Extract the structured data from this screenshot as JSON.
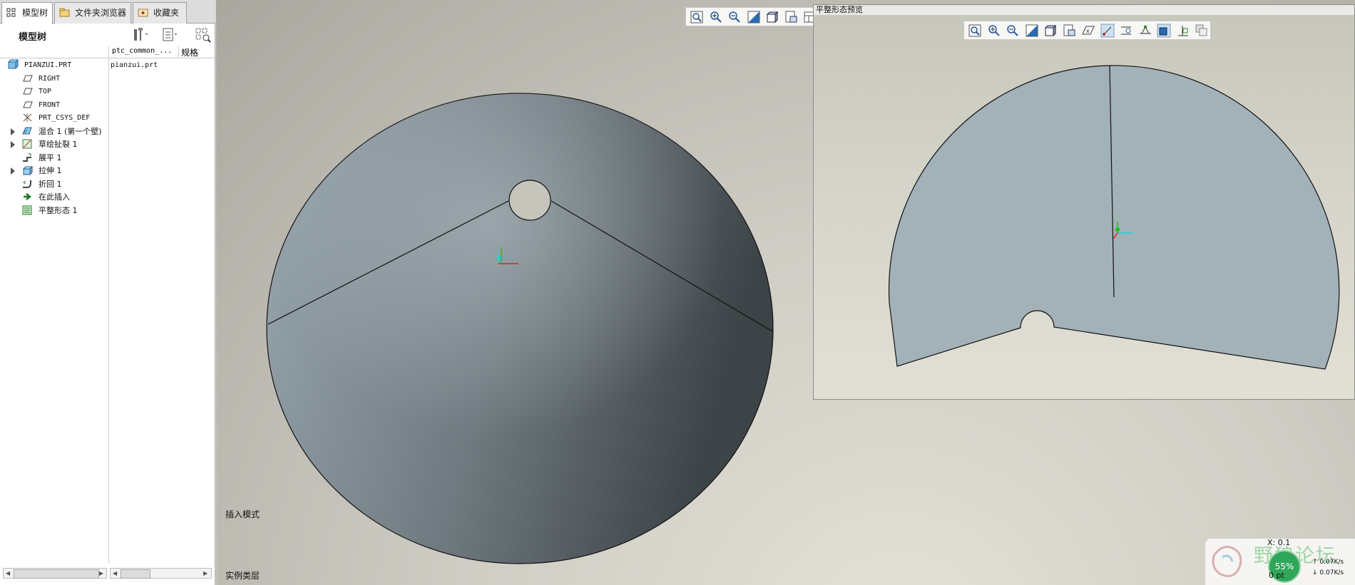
{
  "tabs": [
    {
      "label": "模型树",
      "icon": "model-tree-icon"
    },
    {
      "label": "文件夹浏览器",
      "icon": "folder-browser-icon"
    },
    {
      "label": "收藏夹",
      "icon": "favorites-icon"
    }
  ],
  "tree_header": {
    "title": "模型树"
  },
  "columns": [
    "ptc_common_...",
    "规格"
  ],
  "tree": [
    {
      "label": "PIANZUI.PRT",
      "value": "pianzui.prt",
      "icon": "part-icon",
      "mono": true,
      "expandable": false
    },
    {
      "label": "RIGHT",
      "icon": "datum-plane-icon",
      "mono": true,
      "expandable": false
    },
    {
      "label": "TOP",
      "icon": "datum-plane-icon",
      "mono": true,
      "expandable": false
    },
    {
      "label": "FRONT",
      "icon": "datum-plane-icon",
      "mono": true,
      "expandable": false
    },
    {
      "label": "PRT_CSYS_DEF",
      "icon": "coordinate-system-icon",
      "mono": true,
      "expandable": false
    },
    {
      "label": "混合 1 (第一个壁)",
      "icon": "blend-icon",
      "mono": false,
      "expandable": true
    },
    {
      "label": "草绘扯裂 1",
      "icon": "sketched-rip-icon",
      "mono": false,
      "expandable": true
    },
    {
      "label": "展平 1",
      "icon": "unbend-icon",
      "mono": false,
      "expandable": false
    },
    {
      "label": "拉伸 1",
      "icon": "extrude-icon",
      "mono": false,
      "expandable": true
    },
    {
      "label": "折回 1",
      "icon": "bend-back-icon",
      "mono": false,
      "expandable": false
    },
    {
      "label": "在此插入",
      "icon": "insert-here-arrow-icon",
      "mono": false,
      "expandable": false
    },
    {
      "label": "平整形态 1",
      "icon": "flat-state-icon",
      "mono": false,
      "expandable": false
    }
  ],
  "main_toolbar": [
    "refit-icon",
    "zoom-in-icon",
    "zoom-out-icon",
    "repaint-icon",
    "display-style-icon",
    "saved-views-icon",
    "view-manager-icon"
  ],
  "preview": {
    "title": "平整形态预览",
    "toolbar": [
      "refit-icon",
      "zoom-in-icon",
      "zoom-out-icon",
      "repaint-icon",
      "display-style-icon",
      "saved-views-icon",
      "datum-display-icon",
      "csys-display-icon",
      "spin-center-icon",
      "annotation-icon",
      "shaded-view-icon",
      "orient-icon",
      "overlay-icon"
    ]
  },
  "status": {
    "mode": "插入模式",
    "layer": "实例类层"
  },
  "watermark": {
    "text": "野狼论坛",
    "percent": "55%",
    "speed_up": "0.07K/s",
    "speed_down": "0.07K/s"
  },
  "coords": {
    "x": "X:  0.1",
    "y": "0 pt"
  },
  "colors": {
    "part_fill": "#a3b1b8",
    "cone_light": "#9ba8b0",
    "cone_dark": "#3d4448",
    "edge": "#111111",
    "csys_x": "#e02020",
    "csys_y": "#20c020",
    "csys_z": "#20d0e0"
  }
}
